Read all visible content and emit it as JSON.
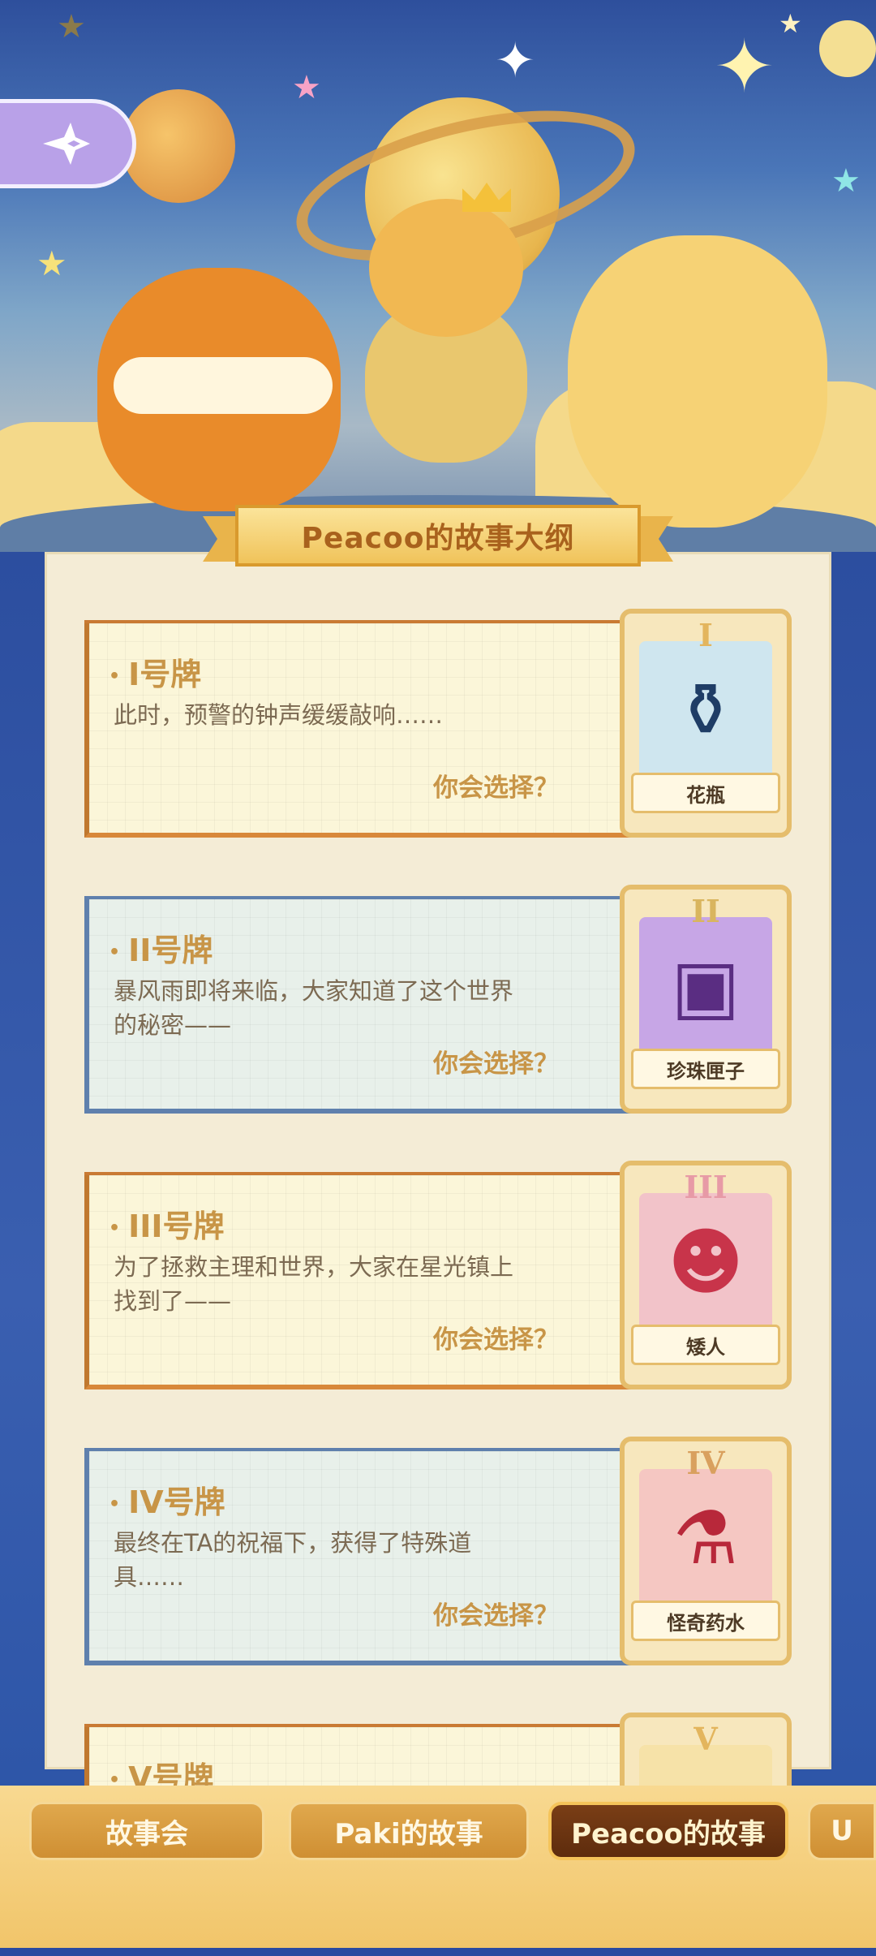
{
  "header": {
    "title": "Peacoo的故事大纲",
    "back_icon": "sparkle-arrow-icon"
  },
  "cards": [
    {
      "heading": "I号牌",
      "text": "此时，预警的钟声缓缓敲响……",
      "choose": "你会选择？",
      "card_numeral": "I",
      "card_name": "花瓶",
      "icon": "vase-icon",
      "theme": "yellow"
    },
    {
      "heading": "II号牌",
      "text": "暴风雨即将来临，大家知道了这个世界的秘密——",
      "choose": "你会选择？",
      "card_numeral": "II",
      "card_name": "珍珠匣子",
      "icon": "pearl-box-icon",
      "theme": "blue"
    },
    {
      "heading": "III号牌",
      "text": "为了拯救主理和世界，大家在星光镇上找到了——",
      "choose": "你会选择？",
      "card_numeral": "III",
      "card_name": "矮人",
      "icon": "dwarf-icon",
      "theme": "yellow"
    },
    {
      "heading": "IV号牌",
      "text": "最终在TA的祝福下，获得了特殊道具……",
      "choose": "你会选择？",
      "card_numeral": "IV",
      "card_name": "怪奇药水",
      "icon": "potion-icon",
      "theme": "blue"
    },
    {
      "heading": "V号牌",
      "card_numeral": "V",
      "theme": "yellow"
    }
  ],
  "tabs": [
    {
      "label": "故事会",
      "active": false
    },
    {
      "label": "Paki的故事",
      "active": false
    },
    {
      "label": "Peacoo的故事",
      "active": true
    },
    {
      "label": "U",
      "active": false
    }
  ],
  "colors": {
    "accent_gold": "#c89547",
    "active_tab": "#5e2c0d",
    "paper": "#f4ecd6"
  }
}
